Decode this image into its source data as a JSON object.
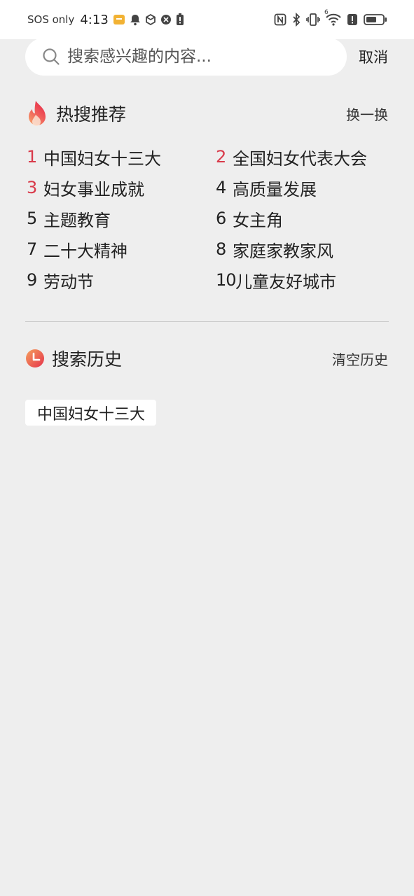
{
  "status_bar": {
    "carrier": "SOS only",
    "time": "4:13",
    "signal_label": "6"
  },
  "search": {
    "placeholder": "搜索感兴趣的内容...",
    "value": "",
    "cancel_label": "取消"
  },
  "hot": {
    "title": "热搜推荐",
    "refresh_label": "换一换",
    "accent": "#d93a4a",
    "items": [
      {
        "rank": "1",
        "text": "中国妇女十三大"
      },
      {
        "rank": "2",
        "text": "全国妇女代表大会"
      },
      {
        "rank": "3",
        "text": "妇女事业成就"
      },
      {
        "rank": "4",
        "text": "高质量发展"
      },
      {
        "rank": "5",
        "text": "主题教育"
      },
      {
        "rank": "6",
        "text": "女主角"
      },
      {
        "rank": "7",
        "text": "二十大精神"
      },
      {
        "rank": "8",
        "text": "家庭家教家风"
      },
      {
        "rank": "9",
        "text": "劳动节"
      },
      {
        "rank": "10",
        "text": "儿童友好城市"
      }
    ]
  },
  "history": {
    "title": "搜索历史",
    "clear_label": "清空历史",
    "items": [
      "中国妇女十三大"
    ]
  }
}
